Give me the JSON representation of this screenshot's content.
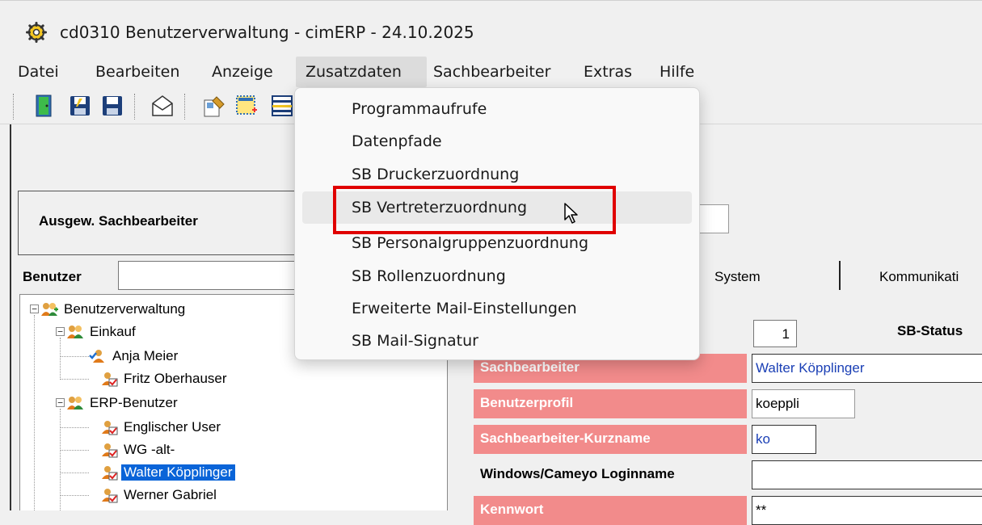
{
  "window": {
    "title": "cd0310 Benutzerverwaltung - cimERP - 24.10.2025"
  },
  "menu": {
    "items": [
      "Datei",
      "Bearbeiten",
      "Anzeige",
      "Zusatzdaten",
      "Sachbearbeiter",
      "Extras",
      "Hilfe"
    ],
    "open": "Zusatzdaten"
  },
  "dropdown": {
    "items": [
      "Programmaufrufe",
      "Datenpfade",
      "SB Druckerzuordnung",
      "SB Vertreterzuordnung",
      "SB Personalgruppenzuordnung",
      "SB Rollenzuordnung",
      "Erweiterte Mail-Einstellungen",
      "SB Mail-Signatur"
    ],
    "hovered": "SB Vertreterzuordnung",
    "highlight_color": "#e00000"
  },
  "selection": {
    "label": "Ausgew. Sachbearbeiter"
  },
  "benutzer": {
    "label": "Benutzer",
    "value": ""
  },
  "tree": {
    "root": "Benutzerverwaltung",
    "groups": [
      {
        "name": "Einkauf",
        "users": [
          "Anja Meier",
          "Fritz Oberhauser"
        ]
      },
      {
        "name": "ERP-Benutzer",
        "users": [
          "Englischer User",
          "WG -alt-",
          "Walter Köpplinger",
          "Werner Gabriel"
        ]
      }
    ],
    "selected": "Walter Köpplinger",
    "selected_color": "#0a64d8"
  },
  "tabs": {
    "system": "System",
    "kommunikation": "Kommunikati"
  },
  "form": {
    "sb_nr": "1",
    "sb_status_label": "SB-Status",
    "sachbearbeiter_label": "Sachbearbeiter",
    "sachbearbeiter_value": "Walter Köpplinger",
    "benutzerprofil_label": "Benutzerprofil",
    "benutzerprofil_value": "koeppli",
    "kurzname_label": "Sachbearbeiter-Kurzname",
    "kurzname_value": "ko",
    "windows_login_label": "Windows/Cameyo Loginname",
    "windows_login_value": "",
    "kennwort_label": "Kennwort",
    "kennwort_value": "**",
    "label_color": "#f28b8b"
  },
  "icons": {
    "title": "gear-icon",
    "toolbar": [
      "exit-door-icon",
      "save-as-icon",
      "save-icon",
      "mail-icon",
      "edit-properties-icon",
      "new-entry-icon",
      "list-icon"
    ],
    "tree_root": "users-add-icon",
    "tree_group": "user-group-icon",
    "tree_user": "user-check-icon"
  }
}
